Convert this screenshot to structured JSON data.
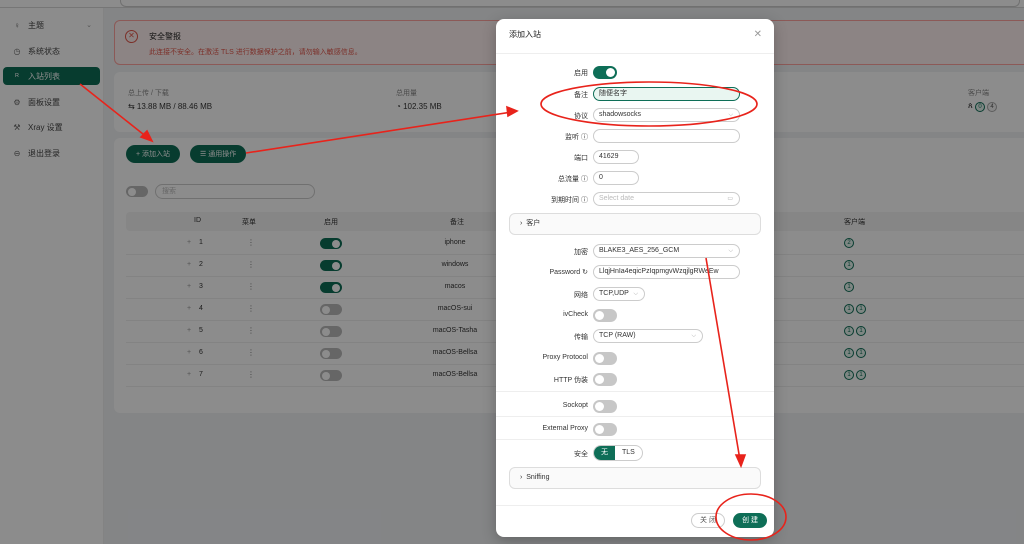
{
  "sidebar": {
    "items": [
      {
        "label": "主题",
        "icon": "bulb-icon"
      },
      {
        "label": "系统状态",
        "icon": "dashboard-icon"
      },
      {
        "label": "入站列表",
        "icon": "user-icon"
      },
      {
        "label": "面板设置",
        "icon": "gear-icon"
      },
      {
        "label": "Xray 设置",
        "icon": "tool-icon"
      },
      {
        "label": "退出登录",
        "icon": "logout-icon"
      }
    ]
  },
  "alert": {
    "title": "安全警报",
    "desc": "此连接不安全。在激活 TLS 进行数据保护之前，请勿输入敏感信息。"
  },
  "stats": {
    "upload_download_label": "总上传 / 下载",
    "upload_download_value": "⇆ 13.88 MB / 88.46 MB",
    "usage_label": "总用量",
    "usage_value": "102.35 MB",
    "clients_label": "客户端",
    "clients_online": "0",
    "clients_total": "4"
  },
  "toolbar": {
    "add_label": "+ 添加入站",
    "general_label": "☰ 通用操作"
  },
  "search": {
    "placeholder": "搜索"
  },
  "table": {
    "headers": [
      "ID",
      "菜单",
      "启用",
      "备注",
      "客户端"
    ],
    "rows": [
      {
        "id": "1",
        "enabled": true,
        "remark": "iphone",
        "badges": [
          "2"
        ]
      },
      {
        "id": "2",
        "enabled": true,
        "remark": "windows",
        "badges": [
          "1"
        ]
      },
      {
        "id": "3",
        "enabled": true,
        "remark": "macos",
        "badges": [
          "1"
        ]
      },
      {
        "id": "4",
        "enabled": false,
        "remark": "macOS-sui",
        "badges": [
          "1",
          "1"
        ]
      },
      {
        "id": "5",
        "enabled": false,
        "remark": "macOS-Tasha",
        "badges": [
          "1",
          "1"
        ]
      },
      {
        "id": "6",
        "enabled": false,
        "remark": "macOS-Bellsa",
        "badges": [
          "1",
          "1"
        ]
      },
      {
        "id": "7",
        "enabled": false,
        "remark": "macOS-Bellsa",
        "badges": [
          "1",
          "1"
        ]
      }
    ]
  },
  "modal": {
    "title": "添加入站",
    "enable_label": "启用",
    "remark_label": "备注",
    "remark_value": "随便名字",
    "protocol_label": "协议",
    "protocol_value": "shadowsocks",
    "listen_label": "监听 ⓘ",
    "listen_value": "",
    "port_label": "端口",
    "port_value": "41629",
    "traffic_label": "总流量 ⓘ",
    "traffic_value": "0",
    "expire_label": "到期时间 ⓘ",
    "expire_placeholder": "Select date",
    "client_section": "客户",
    "cipher_label": "加密",
    "cipher_value": "BLAKE3_AES_256_GCM",
    "password_label": "Password",
    "password_value": "LlqjHnIa4eqicPzIqpmgvWzqjlgRWeEw",
    "network_label": "网络",
    "network_value": "TCP,UDP",
    "ivcheck_label": "ivCheck",
    "transport_label": "传输",
    "transport_value": "TCP (RAW)",
    "proxy_protocol_label": "Proxy Protocol",
    "http_camouflage_label": "HTTP 伪装",
    "sockopt_label": "Sockopt",
    "external_proxy_label": "External Proxy",
    "security_label": "安全",
    "security_options": [
      "无",
      "TLS"
    ],
    "sniffing_section": "Sniffing",
    "close_button": "关 闭",
    "create_button": "创 建"
  },
  "colors": {
    "accent": "#0e6e57",
    "annotation": "#e8231b"
  }
}
